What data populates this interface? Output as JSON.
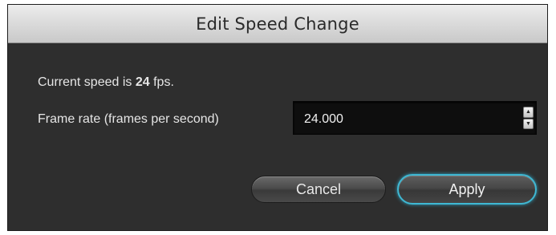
{
  "window": {
    "title": "Edit Speed Change"
  },
  "speed": {
    "prefix": "Current speed is",
    "value": "24",
    "suffix": "fps."
  },
  "frame_rate": {
    "label": "Frame rate (frames per second)",
    "value": "24.000"
  },
  "buttons": {
    "cancel_label": "Cancel",
    "apply_label": "Apply"
  },
  "colors": {
    "accent": "#3fb8d3",
    "dialog_background": "#2e2e2e"
  },
  "icons": {
    "stepper_up": "up-arrow-icon",
    "stepper_down": "down-arrow-icon"
  }
}
